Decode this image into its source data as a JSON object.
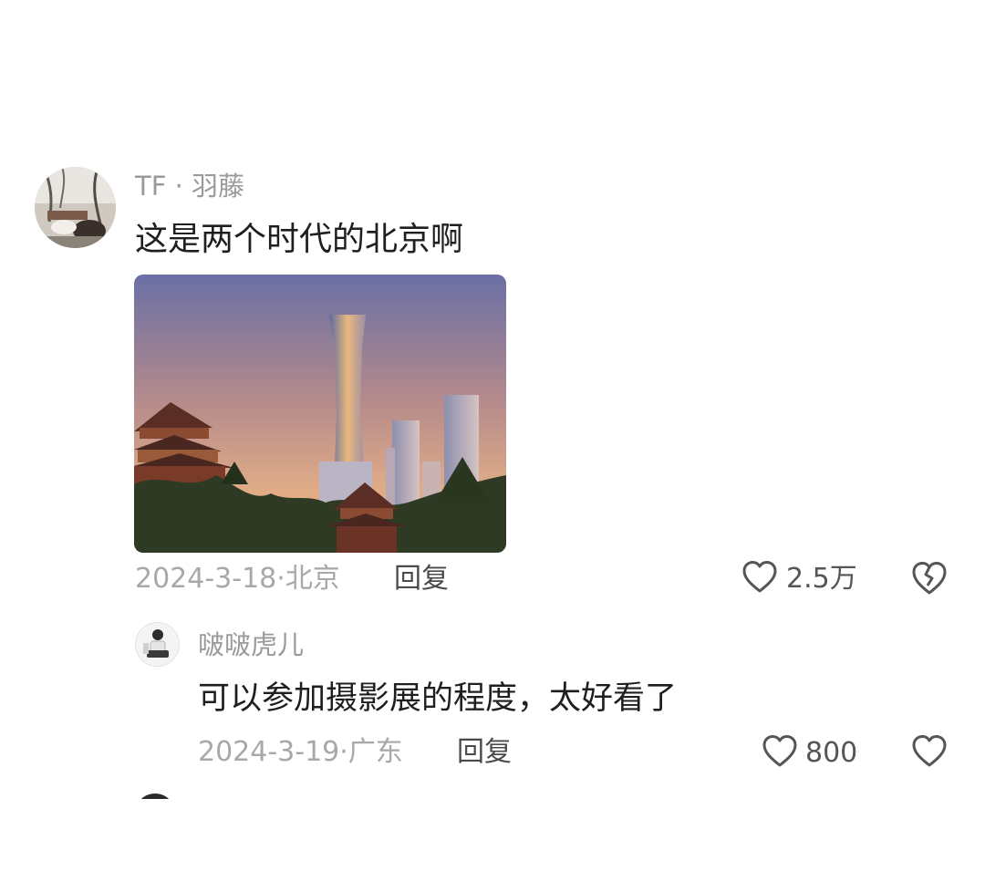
{
  "comments": [
    {
      "username": "TF · 羽藤",
      "text": "这是两个时代的北京啊",
      "date": "2024-3-18",
      "location": "北京",
      "meta_separator": "·",
      "reply_label": "回复",
      "like_count": "2.5万",
      "avatar_icon": "user-avatar-photo",
      "has_image": true,
      "image_description_icon": "photo-thumbnail"
    },
    {
      "username": "啵啵虎儿",
      "text": "可以参加摄影展的程度，太好看了",
      "date": "2024-3-19",
      "location": "广东",
      "meta_separator": "·",
      "reply_label": "回复",
      "like_count": "800",
      "avatar_icon": "user-avatar-photo"
    }
  ],
  "icons": {
    "like": "heart-outline-icon",
    "dislike": "broken-heart-outline-icon"
  },
  "colors": {
    "username": "#9a9a9a",
    "text": "#1f1f1f",
    "meta": "#a8a8a8",
    "reply": "#4a4a4a",
    "icon": "#555555",
    "background": "#ffffff"
  }
}
